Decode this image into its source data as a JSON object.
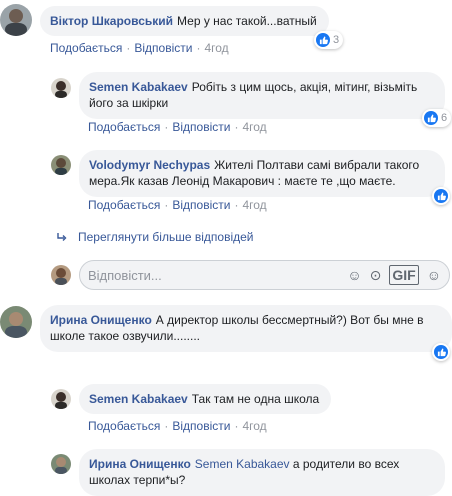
{
  "actions": {
    "like_label": "Подобається",
    "reply_label": "Відповісти"
  },
  "comments": [
    {
      "author": "Віктор Шкаровський",
      "text": "Мер у нас такой...ватный",
      "time": "4год",
      "likes": "3"
    },
    {
      "author": "Semen Kabakaev",
      "text": "Робіть з цим щось, акція, мітинг, візьміть його за шкірки",
      "time": "4год",
      "likes": "6"
    },
    {
      "author": "Volodymyr Nechypas",
      "text": "Жителі Полтави самі вибрали такого мера.Як казав Леонід Макарович : маєте те ,що маєте.",
      "time": "4год",
      "likes": ""
    },
    {
      "author": "Ирина Онищенко",
      "text": "А директор школы бессмертный?) Вот бы мне в школе такое озвучили........",
      "time": "",
      "likes": ""
    },
    {
      "author": "Semen Kabakaev",
      "text": "Так там не одна школа",
      "time": "4год",
      "likes": ""
    },
    {
      "author": "Ирина Онищенко",
      "mention": "Semen Kabakaev",
      "text": "а родители во всех школах терпи*ы?",
      "time": "",
      "likes": ""
    }
  ],
  "more_replies": "Переглянути більше відповідей",
  "reply_box": {
    "placeholder": "Відповісти..."
  },
  "colors": {
    "link": "#385898",
    "like": "#1877f2",
    "bubble": "#f2f3f5"
  }
}
